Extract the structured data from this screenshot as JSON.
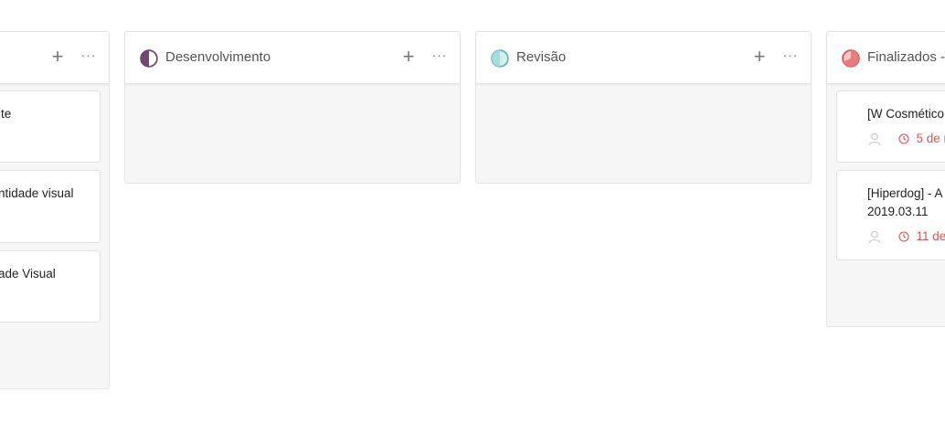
{
  "columns": [
    {
      "title": "",
      "cards": [
        {
          "title": "ite"
        },
        {
          "title": "ntidade visual"
        },
        {
          "title": "ade Visual"
        }
      ]
    },
    {
      "title": "Desenvolvimento",
      "status_color": "#6b4b6e",
      "cards": []
    },
    {
      "title": "Revisão",
      "status_color": "#5db7b5",
      "cards": []
    },
    {
      "title": "Finalizados -",
      "status_color": "#e05252",
      "cards": [
        {
          "title": "[W Cosmético",
          "due": "5 de m"
        },
        {
          "title": "[Hiperdog] - A\n2019.03.11",
          "due": "11 de"
        }
      ]
    }
  ],
  "icons": {
    "add": "plus-icon",
    "more": "more-horizontal-icon",
    "assignee": "user-icon",
    "due": "clock-icon"
  },
  "symbols": {
    "add": "+",
    "more": "···"
  },
  "colors": {
    "due_overdue": "#e05252",
    "column_bg": "#f6f6f6"
  }
}
